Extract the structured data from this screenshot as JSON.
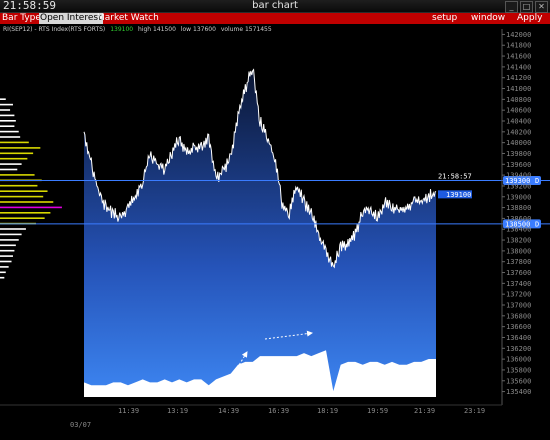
{
  "window": {
    "clock": "21:58:59",
    "title": "bar chart",
    "buttons": [
      "_",
      "□",
      "✕"
    ]
  },
  "menu": {
    "left": [
      "Bar Type",
      "Open Interest",
      "Market Watch"
    ],
    "active": "Open Interest",
    "right": [
      "setup",
      "window",
      "Apply"
    ]
  },
  "info": {
    "symbol": "RI(SEP12) - RTS Index(RTS FORTS)",
    "last": "139100",
    "high": "high 141500",
    "low": "low 137600",
    "volume": "volume 1571455"
  },
  "colors": {
    "menu_red": "#c00000",
    "price_line": "#ffffff",
    "area_top": "#0d1a3a",
    "area_bottom": "#3b82f0",
    "level_line": "#3a7cff",
    "profile_yellow": "#d8d800",
    "profile_white": "#ffffff",
    "profile_magenta": "#e000e0",
    "last_tag": "#1e5be0"
  },
  "price_axis": {
    "ticks": [
      "142000",
      "141800",
      "141600",
      "141400",
      "141200",
      "141000",
      "140800",
      "140600",
      "140400",
      "140200",
      "140000",
      "139800",
      "139600",
      "139400",
      "139200",
      "139000",
      "138800",
      "138600",
      "138400",
      "138200",
      "138000",
      "137800",
      "137600",
      "137400",
      "137200",
      "137000",
      "136800",
      "136600",
      "136400",
      "136200",
      "136000",
      "135800",
      "135600",
      "135400"
    ]
  },
  "levels": {
    "upper": {
      "price": "139300",
      "flag": "D",
      "time": "21:58:57"
    },
    "lower": {
      "price": "138500",
      "flag": "D"
    },
    "last_tag": "139100"
  },
  "time_axis": {
    "date": "03/07",
    "ticks": [
      "11:39",
      "13:19",
      "14:39",
      "16:39",
      "18:19",
      "19:59",
      "21:39",
      "23:19"
    ]
  },
  "chart_data": {
    "type": "line",
    "x": [
      "10:00",
      "10:15",
      "10:30",
      "10:45",
      "11:00",
      "11:15",
      "11:30",
      "11:45",
      "12:00",
      "12:15",
      "12:30",
      "12:45",
      "13:00",
      "13:15",
      "13:30",
      "13:45",
      "14:00",
      "14:15",
      "14:30",
      "14:45",
      "15:00",
      "15:15",
      "15:30",
      "15:45",
      "16:00",
      "16:15",
      "16:30",
      "16:45",
      "17:00",
      "17:15",
      "17:30",
      "17:45",
      "18:00",
      "18:15",
      "18:30",
      "18:45",
      "19:00",
      "19:15",
      "19:30",
      "19:45",
      "20:00",
      "20:15",
      "20:30",
      "20:45",
      "21:00",
      "21:15",
      "21:30",
      "21:45",
      "21:58"
    ],
    "series": [
      {
        "values": [
          140200,
          139600,
          139100,
          138800,
          138700,
          138600,
          138800,
          139000,
          139300,
          139800,
          139600,
          139500,
          139800,
          140100,
          139800,
          139900,
          139900,
          140100,
          139300,
          139500,
          139700,
          140500,
          141000,
          141400,
          140400,
          140100,
          139700,
          138900,
          138700,
          139200,
          138900,
          138700,
          138300,
          138000,
          137700,
          138100,
          138100,
          138300,
          138700,
          138800,
          138600,
          138900,
          138800,
          138800,
          138800,
          138900,
          138900,
          139000,
          139100
        ]
      }
    ],
    "volume": [
      5,
      4,
      4,
      4,
      5,
      5,
      4,
      5,
      6,
      5,
      5,
      6,
      5,
      6,
      5,
      6,
      6,
      4,
      6,
      7,
      8,
      11,
      12,
      12,
      14,
      14,
      14,
      14,
      14,
      14,
      15,
      14,
      15,
      16,
      2,
      11,
      12,
      12,
      11,
      12,
      12,
      11,
      12,
      11,
      11,
      12,
      12,
      13,
      13
    ],
    "ylim": [
      135300,
      142100
    ]
  },
  "profile": {
    "bars": [
      {
        "price": 140800,
        "len": 8,
        "c": "w"
      },
      {
        "price": 140700,
        "len": 18,
        "c": "w"
      },
      {
        "price": 140600,
        "len": 14,
        "c": "w"
      },
      {
        "price": 140500,
        "len": 20,
        "c": "w"
      },
      {
        "price": 140400,
        "len": 22,
        "c": "w"
      },
      {
        "price": 140300,
        "len": 20,
        "c": "w"
      },
      {
        "price": 140200,
        "len": 26,
        "c": "w"
      },
      {
        "price": 140100,
        "len": 28,
        "c": "w"
      },
      {
        "price": 140000,
        "len": 40,
        "c": "y"
      },
      {
        "price": 139900,
        "len": 56,
        "c": "y"
      },
      {
        "price": 139800,
        "len": 46,
        "c": "y"
      },
      {
        "price": 139700,
        "len": 38,
        "c": "y"
      },
      {
        "price": 139600,
        "len": 30,
        "c": "w"
      },
      {
        "price": 139500,
        "len": 24,
        "c": "w"
      },
      {
        "price": 139400,
        "len": 48,
        "c": "y"
      },
      {
        "price": 139300,
        "len": 58,
        "c": "y"
      },
      {
        "price": 139200,
        "len": 52,
        "c": "y"
      },
      {
        "price": 139100,
        "len": 66,
        "c": "y"
      },
      {
        "price": 139000,
        "len": 60,
        "c": "y"
      },
      {
        "price": 138900,
        "len": 74,
        "c": "y"
      },
      {
        "price": 138800,
        "len": 86,
        "c": "m"
      },
      {
        "price": 138700,
        "len": 70,
        "c": "y"
      },
      {
        "price": 138600,
        "len": 62,
        "c": "y"
      },
      {
        "price": 138500,
        "len": 50,
        "c": "y"
      },
      {
        "price": 138400,
        "len": 36,
        "c": "w"
      },
      {
        "price": 138300,
        "len": 30,
        "c": "w"
      },
      {
        "price": 138200,
        "len": 26,
        "c": "w"
      },
      {
        "price": 138100,
        "len": 22,
        "c": "w"
      },
      {
        "price": 138000,
        "len": 20,
        "c": "w"
      },
      {
        "price": 137900,
        "len": 18,
        "c": "w"
      },
      {
        "price": 137800,
        "len": 16,
        "c": "w"
      },
      {
        "price": 137700,
        "len": 12,
        "c": "w"
      },
      {
        "price": 137600,
        "len": 8,
        "c": "w"
      },
      {
        "price": 137500,
        "len": 6,
        "c": "w"
      }
    ]
  },
  "annotations": [
    {
      "type": "arrow",
      "label": "up-arrow"
    },
    {
      "type": "arrow",
      "label": "right-arrow"
    }
  ]
}
